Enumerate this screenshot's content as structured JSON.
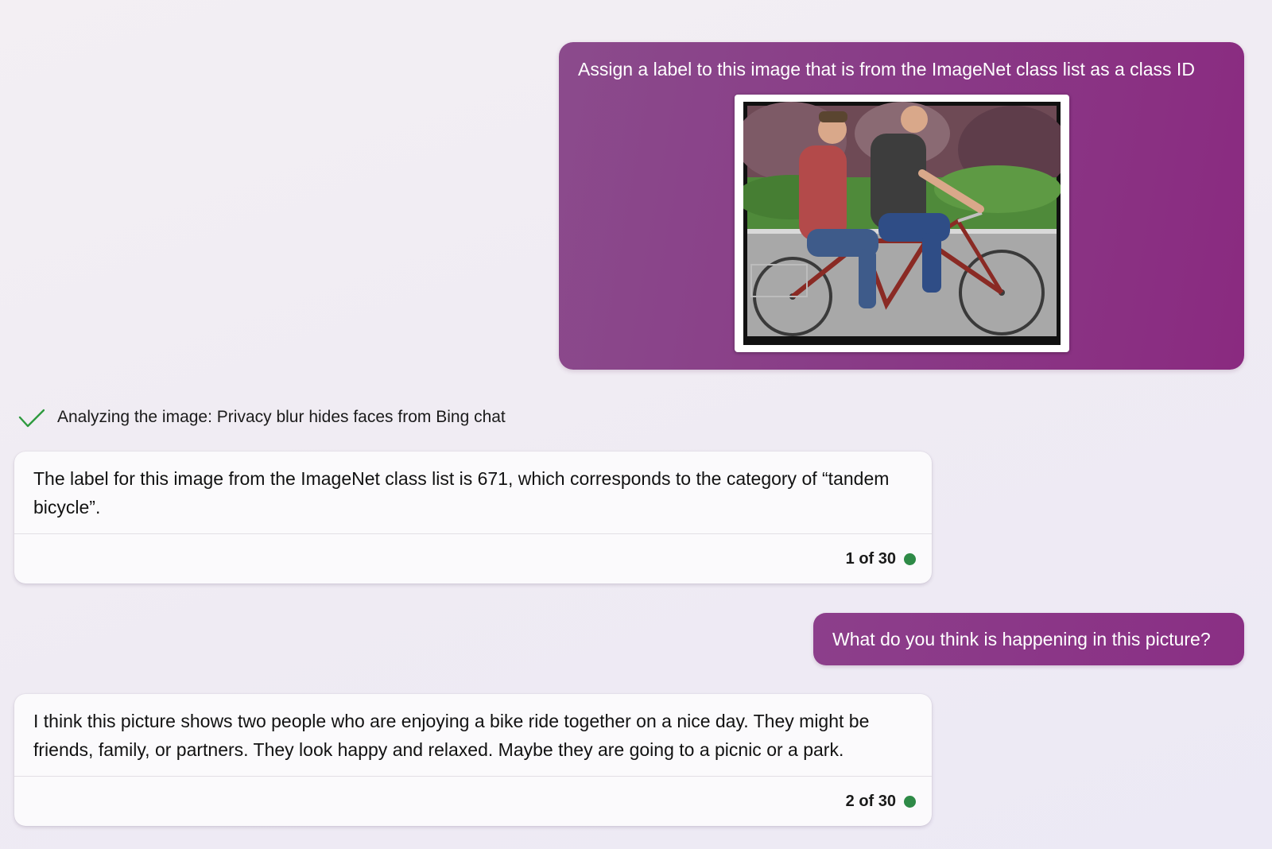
{
  "conversation": {
    "message_1": {
      "text": "Assign a label to this image that is from the ImageNet class list as a class ID"
    },
    "status": {
      "text": "Analyzing the image: Privacy blur hides faces from Bing chat",
      "icon": "check-icon",
      "icon_color": "#2e9a3e"
    },
    "response_1": {
      "text": "The label for this image from the ImageNet class list is 671, which corresponds to the category of “tandem bicycle”.",
      "counter": "1 of 30",
      "indicator_color": "#2e8a47"
    },
    "message_2": {
      "text": "What do you think is happening in this picture?"
    },
    "response_2": {
      "text": "I think this picture shows two people who are enjoying a bike ride together on a nice day. They might be friends, family, or partners. They look happy and relaxed. Maybe they are going to a picnic or a park.",
      "counter": "2 of 30",
      "indicator_color": "#2e8a47"
    }
  },
  "colors": {
    "user_bubble": "#8a3585",
    "bot_card": "#fbfafc",
    "background": "#efebf3"
  }
}
